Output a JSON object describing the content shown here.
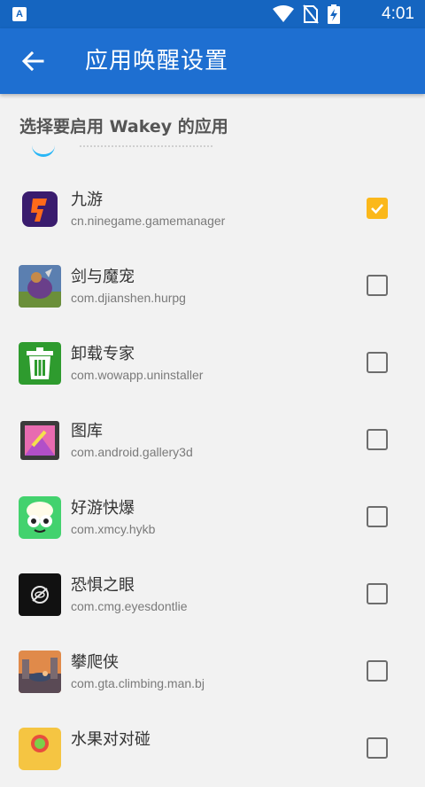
{
  "status_bar": {
    "time": "4:01",
    "notification_icon": "a-icon",
    "icons": [
      "wifi-icon",
      "no-sim-icon",
      "battery-charging-icon"
    ]
  },
  "app_bar": {
    "title": "应用唤醒设置",
    "back_icon": "arrow-left-icon"
  },
  "section_header": "选择要启用 Wakey 的应用",
  "colors": {
    "app_bar": "#1e6fd1",
    "status_bar": "#1565c0",
    "checkbox_checked": "#fbb81b",
    "background": "#f2f2f2"
  },
  "apps": [
    {
      "name": "九游",
      "package": "cn.ninegame.gamemanager",
      "checked": true,
      "icon": "jiuyou-app-icon"
    },
    {
      "name": "剑与魔宠",
      "package": "com.djianshen.hurpg",
      "checked": false,
      "icon": "jianyumochong-app-icon"
    },
    {
      "name": "卸载专家",
      "package": "com.wowapp.uninstaller",
      "checked": false,
      "icon": "uninstaller-trash-icon"
    },
    {
      "name": "图库",
      "package": "com.android.gallery3d",
      "checked": false,
      "icon": "gallery-app-icon"
    },
    {
      "name": "好游快爆",
      "package": "com.xmcy.hykb",
      "checked": false,
      "icon": "hykb-app-icon"
    },
    {
      "name": "恐惧之眼",
      "package": "com.cmg.eyesdontlie",
      "checked": false,
      "icon": "eyes-app-icon"
    },
    {
      "name": "攀爬侠",
      "package": "com.gta.climbing.man.bj",
      "checked": false,
      "icon": "climbing-man-app-icon"
    },
    {
      "name": "水果对对碰",
      "package": "",
      "checked": false,
      "icon": "fruit-match-app-icon"
    }
  ]
}
